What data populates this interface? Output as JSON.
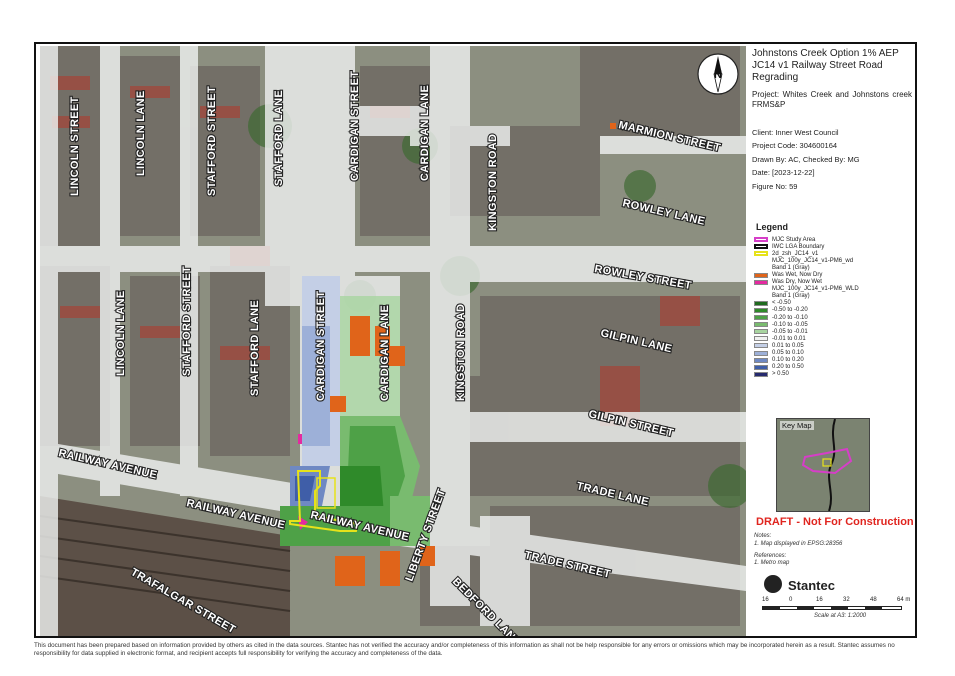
{
  "title": "Johnstons Creek Option 1% AEP JC14 v1 Railway Street Road Regrading",
  "project": "Project:  Whites Creek and Johnstons creek FRMS&P",
  "client": "Client:  Inner West Council",
  "project_code": "Project Code:  304600164",
  "drawn_by": "Drawn By:  AC, Checked By: MG",
  "date": "Date:  [2023-12-22]",
  "figure_no": "Figure No:  59",
  "legend": {
    "title": "Legend",
    "items": [
      {
        "label": "MJC Study Area",
        "color": "#d63ec8",
        "style": "outline"
      },
      {
        "label": "IWC LGA Boundary",
        "color": "#111111",
        "style": "outline"
      },
      {
        "label": "2d_zsh_JC14_v1",
        "color": "#e6e21a",
        "style": "outline"
      },
      {
        "label": "MJC_100y_JC14_v1-PM6_wd",
        "color": "",
        "style": "text"
      },
      {
        "label": "Band 1 (Gray)",
        "color": "",
        "style": "text"
      },
      {
        "label": "Was Wet, Now Dry",
        "color": "#e0641a",
        "style": "fill"
      },
      {
        "label": "Was Dry, Now Wet",
        "color": "#e42aa0",
        "style": "fill"
      },
      {
        "label": "MJC_100y_JC14_v1-PM6_WLD",
        "color": "",
        "style": "text"
      },
      {
        "label": "Band 1 (Gray)",
        "color": "",
        "style": "text"
      },
      {
        "label": "< -0.50",
        "color": "#1f6b1f",
        "style": "fill"
      },
      {
        "label": "-0.50 to -0.20",
        "color": "#2f8a2a",
        "style": "fill"
      },
      {
        "label": "-0.20 to -0.10",
        "color": "#4ea147",
        "style": "fill"
      },
      {
        "label": "-0.10 to -0.05",
        "color": "#79bb6f",
        "style": "fill"
      },
      {
        "label": "-0.05 to -0.01",
        "color": "#a8d4a0",
        "style": "fill"
      },
      {
        "label": "-0.01 to 0.01",
        "color": "#f2f2f2",
        "style": "fill"
      },
      {
        "label": "0.01 to 0.05",
        "color": "#c4cfe6",
        "style": "fill"
      },
      {
        "label": "0.05 to 0.10",
        "color": "#9db0d8",
        "style": "fill"
      },
      {
        "label": "0.10 to 0.20",
        "color": "#6f89c3",
        "style": "fill"
      },
      {
        "label": "0.20 to 0.50",
        "color": "#3f5ea8",
        "style": "fill"
      },
      {
        "label": "> 0.50",
        "color": "#262a6e",
        "style": "fill"
      }
    ]
  },
  "key_map_label": "Key Map",
  "draft": "DRAFT - Not For Construction",
  "notes_title": "Notes:",
  "notes_text": "1. Map displayed in EPSG:28356",
  "references_title": "References:",
  "references_text": "1. Metro map",
  "logo_text": "Stantec",
  "scale": {
    "ticks": [
      "16",
      "0",
      "16",
      "32",
      "48",
      "64 m"
    ],
    "label": "Scale at A3: 1:2000"
  },
  "north_label": "N",
  "streets": [
    "LINCOLN STREET",
    "LINCOLN LANE",
    "STAFFORD STREET",
    "STAFFORD LANE",
    "CARDIGAN STREET",
    "CARDIGAN LANE",
    "KINGSTON ROAD",
    "MARMION STREET",
    "ROWLEY LANE",
    "ROWLEY STREET",
    "GILPIN LANE",
    "GILPIN STREET",
    "RAILWAY AVENUE",
    "TRADE LANE",
    "TRADE STREET",
    "LIBERTY STREET",
    "BEDFORD LANE",
    "TRAFALGAR STREET"
  ],
  "disclaimer": "This document has been prepared based on information provided by others as cited in the data sources. Stantec has not verified the accuracy and/or completeness of this information as shall not be help responsible for any errors or omissions which may be incorporated herein as a result. Stantec assumes no responsibility for data supplied in electronic format, and recipient accepts full responsibility for verifying the accuracy and completeness of the data."
}
